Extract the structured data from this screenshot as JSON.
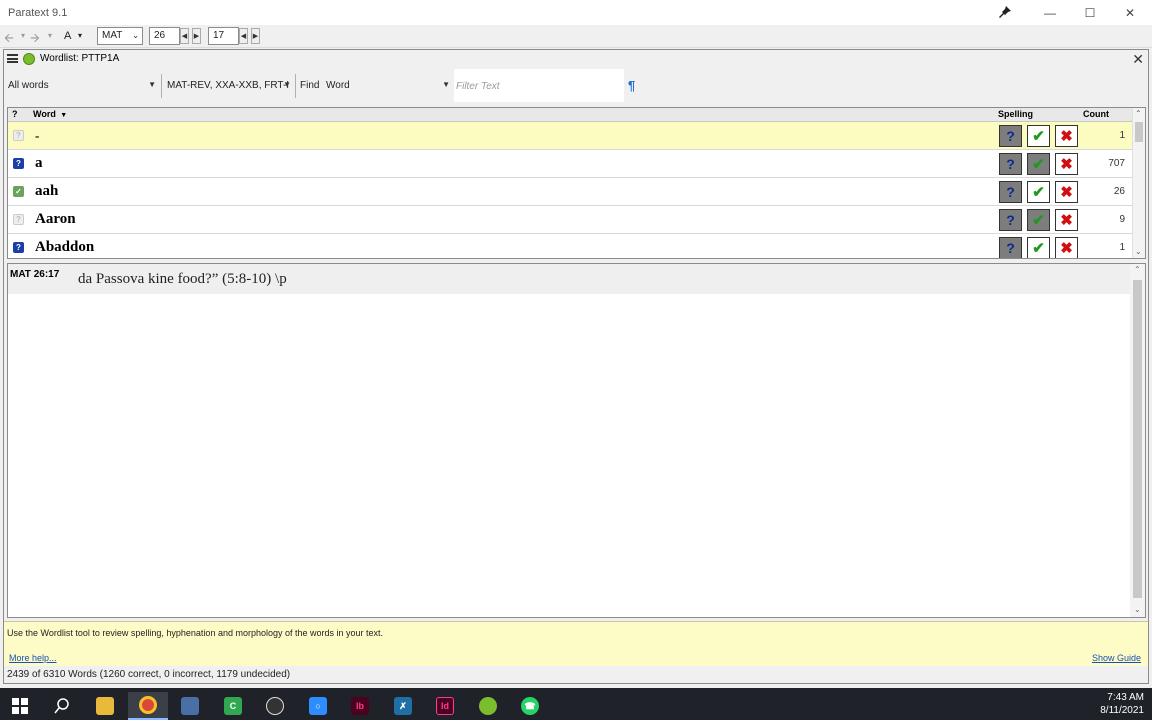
{
  "window": {
    "title": "Paratext 9.1"
  },
  "nav": {
    "font_label": "A",
    "book": "MAT",
    "chapter": "26",
    "verse": "17"
  },
  "pane": {
    "title": "Wordlist: PTTP1A"
  },
  "filters": {
    "words_filter": "All words",
    "books_filter": "MAT-REV, XXA-XXB, FRT-I",
    "find_label": "Find",
    "find_field": "Word",
    "filter_placeholder": "Filter Text"
  },
  "list": {
    "headers": {
      "status": "?",
      "word": "Word",
      "spelling": "Spelling",
      "count": "Count"
    },
    "rows": [
      {
        "word": "-",
        "count": "1",
        "status": "blank",
        "selected": true
      },
      {
        "word": "a",
        "count": "707",
        "status": "question",
        "selected": false
      },
      {
        "word": "aah",
        "count": "26",
        "status": "approved",
        "selected": false
      },
      {
        "word": "Aaron",
        "count": "9",
        "status": "blank",
        "selected": false
      },
      {
        "word": "Abaddon",
        "count": "1",
        "status": "question",
        "selected": false
      }
    ]
  },
  "reference": {
    "ref": "MAT  26:17",
    "text": "da Passova kine food?” (5:8-10) \\p"
  },
  "guide": {
    "text": "Use the Wordlist tool to review spelling, hyphenation and morphology of the words in your text.",
    "more_help": "More help...",
    "show_guide": "Show Guide"
  },
  "status": {
    "text": "2439 of 6310 Words (1260 correct, 0 incorrect, 1179 undecided)"
  },
  "taskbar": {
    "time": "7:43 AM",
    "date": "8/11/2021",
    "apps": [
      "windows-start",
      "search",
      "file-explorer",
      "chrome",
      "app-generic",
      "camtasia",
      "obs",
      "zoom",
      "indesign-alt",
      "paratext-x",
      "indesign",
      "paratext",
      "whatsapp"
    ]
  },
  "colors": {
    "selected_row": "#fdfcc0",
    "guide_bg": "#fdfcc6",
    "link": "#1a4fb8",
    "approve": "#1d9a1d",
    "reject": "#d01010"
  }
}
